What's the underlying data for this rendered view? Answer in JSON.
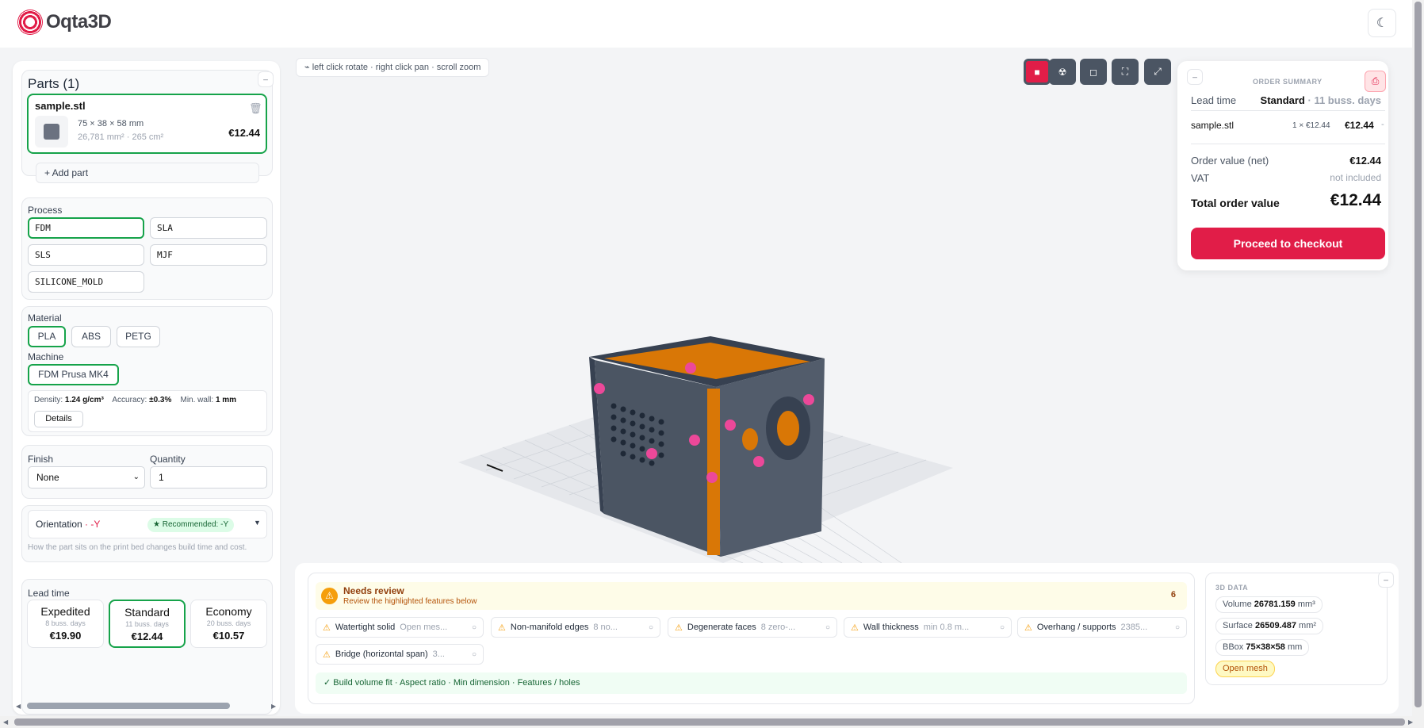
{
  "app": {
    "name": "Oqta3D"
  },
  "parts": {
    "title": "Parts (1)",
    "item": {
      "name": "sample.stl",
      "dims": "75 × 38 × 58 mm",
      "stats": "26,781 mm² · 265 cm²",
      "price": "€12.44"
    },
    "add_label": "+ Add part"
  },
  "process": {
    "title": "Process",
    "options": [
      "FDM",
      "SLA",
      "SLS",
      "MJF",
      "SILICONE_MOLD"
    ],
    "selected": "FDM"
  },
  "material": {
    "title": "Material",
    "options": [
      "PLA",
      "ABS",
      "PETG"
    ],
    "selected": "PLA"
  },
  "machine": {
    "title": "Machine",
    "selected": "FDM Prusa MK4"
  },
  "specs": {
    "density_label": "Density:",
    "density": "1.24 g/cm³",
    "accuracy_label": "Accuracy:",
    "accuracy": "±0.3%",
    "minwall_label": "Min. wall:",
    "minwall": "1 mm",
    "details_label": "Details"
  },
  "finish": {
    "title": "Finish",
    "value": "None"
  },
  "quantity": {
    "title": "Quantity",
    "value": "1"
  },
  "orientation": {
    "label": "Orientation",
    "value": "-Y",
    "recommended": "★ Recommended: -Y",
    "help": "How the part sits on the print bed changes build time and cost."
  },
  "leadtime": {
    "title": "Lead time",
    "options": [
      {
        "name": "Expedited",
        "days": "8 buss. days",
        "price": "€19.90"
      },
      {
        "name": "Standard",
        "days": "11 buss. days",
        "price": "€12.44"
      },
      {
        "name": "Economy",
        "days": "20 buss. days",
        "price": "€10.57"
      }
    ],
    "selected": "Standard"
  },
  "viewer": {
    "hint": "left click rotate · right click pan · scroll zoom"
  },
  "order": {
    "title": "ORDER SUMMARY",
    "lead_label": "Lead time",
    "lead_value": "Standard",
    "lead_days": "· 11 buss. days",
    "line": {
      "name": "sample.stl",
      "qty": "1 × €12.44",
      "price": "€12.44",
      "dash": "-"
    },
    "net_label": "Order value (net)",
    "net": "€12.44",
    "vat_label": "VAT",
    "vat": "not included",
    "total_label": "Total order value",
    "total": "€12.44",
    "checkout_label": "Proceed to checkout"
  },
  "review": {
    "title": "Needs review",
    "subtitle": "Review the highlighted features below",
    "count": "6",
    "issues": [
      {
        "name": "Watertight solid",
        "desc": "Open mes..."
      },
      {
        "name": "Non-manifold edges",
        "desc": "8 no..."
      },
      {
        "name": "Degenerate faces",
        "desc": "8 zero-..."
      },
      {
        "name": "Wall thickness",
        "desc": "min 0.8 m..."
      },
      {
        "name": "Overhang / supports",
        "desc": "2385..."
      },
      {
        "name": "Bridge (horizontal span)",
        "desc": "3..."
      }
    ],
    "passed": "✓  Build volume fit · Aspect ratio · Min dimension · Features / holes"
  },
  "data3d": {
    "title": "3D DATA",
    "volume_label": "Volume",
    "volume": "26781.159",
    "volume_unit": "mm³",
    "surface_label": "Surface",
    "surface": "26509.487",
    "surface_unit": "mm²",
    "bbox_label": "BBox",
    "bbox": "75×38×58",
    "bbox_unit": "mm",
    "badge": "Open mesh"
  },
  "colors": {
    "accent": "#e11d48",
    "selected": "#16a34a",
    "model": "#4b5563",
    "model_accent": "#d97706",
    "markers": "#ec4899"
  }
}
